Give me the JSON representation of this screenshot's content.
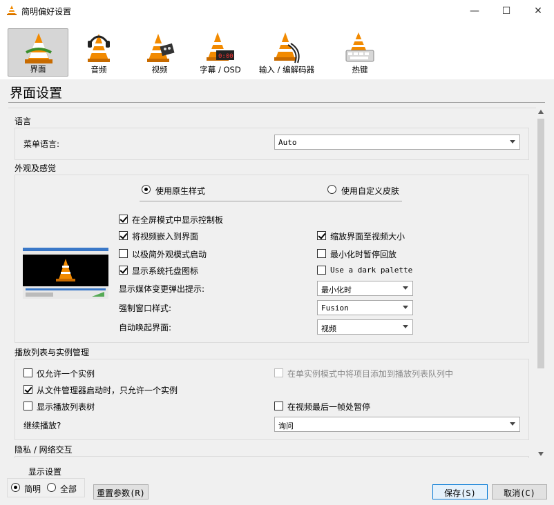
{
  "window": {
    "title": "简明偏好设置",
    "minimize": "—",
    "maximize": "☐",
    "close": "✕"
  },
  "toolbar": {
    "items": [
      {
        "label": "界面"
      },
      {
        "label": "音频"
      },
      {
        "label": "视频"
      },
      {
        "label": "字幕 / OSD"
      },
      {
        "label": "输入 / 编解码器"
      },
      {
        "label": "热键"
      }
    ]
  },
  "section_title": "界面设置",
  "language": {
    "group_label": "语言",
    "menu_lang_label": "菜单语言:",
    "menu_lang_value": "Auto"
  },
  "appearance": {
    "group_label": "外观及感觉",
    "native_style": "使用原生样式",
    "custom_skin": "使用自定义皮肤",
    "fullscreen_controls": "在全屏模式中显示控制板",
    "embed_video": "将视频嵌入到界面",
    "minimal_start": "以极简外观模式启动",
    "systray": "显示系统托盘图标",
    "resize_to_video": "缩放界面至视频大小",
    "pause_minimized": "最小化时暂停回放",
    "dark_palette": "Use a dark palette",
    "popup_label": "显示媒体变更弹出提示:",
    "popup_value": "最小化时",
    "style_label": "强制窗口样式:",
    "style_value": "Fusion",
    "raise_label": "自动唤起界面:",
    "raise_value": "视频"
  },
  "playlist": {
    "group_label": "播放列表与实例管理",
    "one_instance": "仅允许一个实例",
    "enqueue_one": "在单实例模式中将项目添加到播放列表队列中",
    "file_manager_one": "从文件管理器启动时，只允许一个实例",
    "show_tree": "显示播放列表树",
    "pause_last_frame": "在视频最后一帧处暂停",
    "continue_label": "继续播放?",
    "continue_value": "询问"
  },
  "privacy": {
    "group_label": "隐私 / 网络交互"
  },
  "footer": {
    "show_settings": "显示设置",
    "simple": "简明",
    "all": "全部",
    "reset": "重置参数(R)",
    "save": "保存(S)",
    "cancel": "取消(C)"
  },
  "colors": {
    "accent": "#0078d7",
    "cone_orange": "#f28a00"
  }
}
